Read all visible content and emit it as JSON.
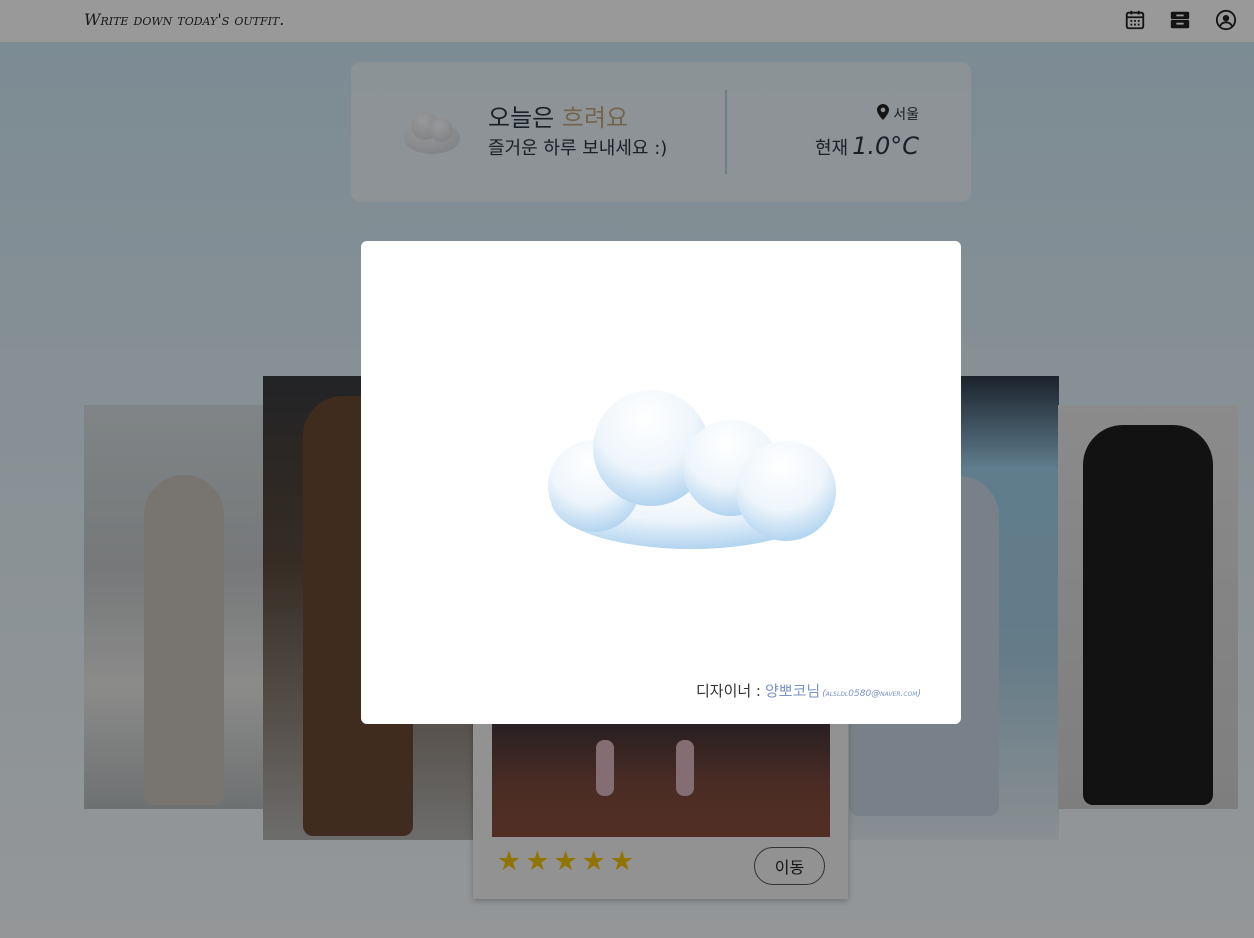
{
  "header": {
    "brand": "Write down today's outfit.",
    "icons": [
      "calendar-icon",
      "inbox-icon",
      "user-circle-icon"
    ]
  },
  "weather": {
    "greeting_prefix": "오늘은 ",
    "condition": "흐려요",
    "subtitle": "즐거운 하루 보내세요 :)",
    "location": "서울",
    "current_label": "현재",
    "temperature": "1.0°C",
    "icon": "cloud-icon"
  },
  "carousel": {
    "center_card": {
      "rating": 5,
      "stars": [
        "★",
        "★",
        "★",
        "★",
        "★"
      ],
      "move_button": "이동"
    }
  },
  "modal": {
    "image": "cloud-illustration",
    "designer_label": "디자이너 : ",
    "designer_name": "양뽀코님",
    "designer_email": "(alsldl0580@naver.com)"
  },
  "colors": {
    "accent_condition": "#c4a882",
    "star": "#f2c200",
    "designer_link": "#7a93c8",
    "overlay": "rgba(0,0,0,0.4)"
  }
}
